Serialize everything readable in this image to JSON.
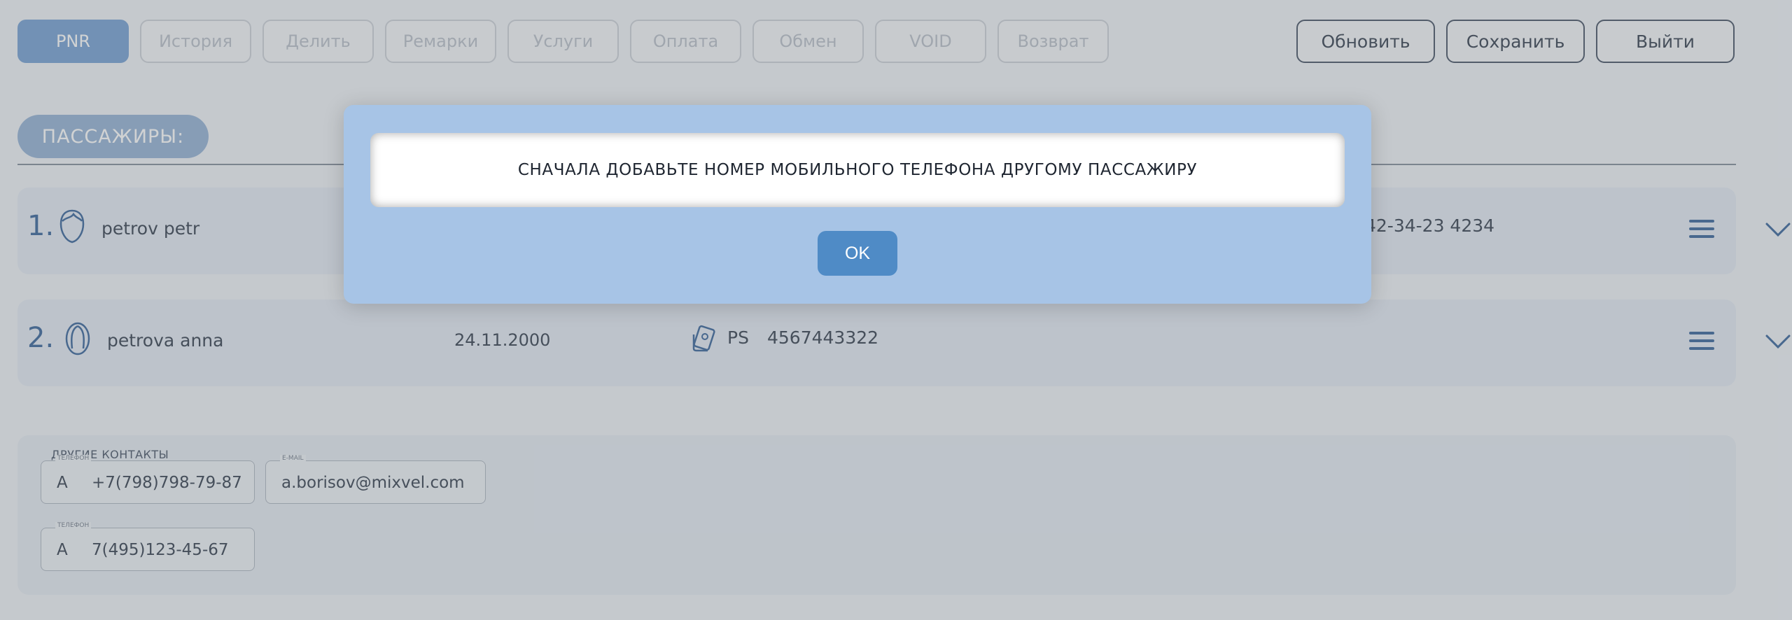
{
  "toolbar": {
    "tabs": [
      {
        "label": "PNR",
        "active": true
      },
      {
        "label": "История",
        "active": false
      },
      {
        "label": "Делить",
        "active": false
      },
      {
        "label": "Ремарки",
        "active": false
      },
      {
        "label": "Услуги",
        "active": false
      },
      {
        "label": "Оплата",
        "active": false
      },
      {
        "label": "Обмен",
        "active": false
      },
      {
        "label": "VOID",
        "active": false
      },
      {
        "label": "Возврат",
        "active": false
      }
    ],
    "refresh_label": "Обновить",
    "save_label": "Сохранить",
    "exit_label": "Выйти"
  },
  "passengers": {
    "header": "ПАССАЖИРЫ:",
    "list": [
      {
        "number": "1.",
        "icon": "male-face-icon",
        "name": "petrov petr",
        "phone_partial": "42-34-23 4234"
      },
      {
        "number": "2.",
        "icon": "female-face-icon",
        "name": "petrova anna",
        "dob": "24.11.2000",
        "doc_type": "PS",
        "doc_number": "4567443322"
      }
    ]
  },
  "contacts": {
    "title": "ДРУГИЕ КОНТАКТЫ",
    "phone_label": "ТЕЛЕФОН",
    "email_label": "E-MAIL",
    "phone1_type": "A",
    "phone1_value": "+7(798)798-79-87",
    "email_value": "a.borisov@mixvel.com",
    "phone2_type": "A",
    "phone2_value": "7(495)123-45-67"
  },
  "dialog": {
    "message": "СНАЧАЛА ДОБАВЬТЕ НОМЕР МОБИЛЬНОГО ТЕЛЕФОНА ДРУГОМУ ПАССАЖИРУ",
    "ok_label": "OK"
  },
  "colors": {
    "accent": "#6f9bd1",
    "dialog_bg": "#a7c4e6",
    "ok_button": "#4f8bc6",
    "number": "#2f5d96"
  }
}
